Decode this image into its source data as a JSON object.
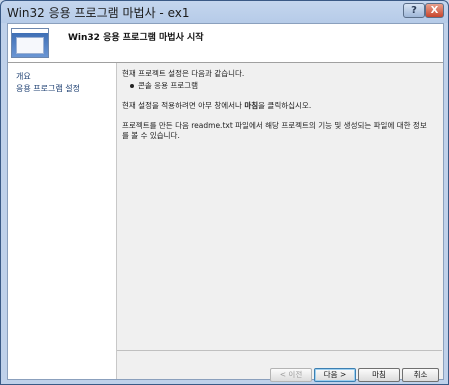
{
  "window": {
    "title": "Win32 응용 프로그램 마법사 - ex1",
    "help_label": "?",
    "close_label": "X"
  },
  "header": {
    "title": "Win32 응용 프로그램 마법사 시작"
  },
  "sidebar": {
    "items": [
      {
        "label": "개요"
      },
      {
        "label": "응용 프로그램 설정"
      }
    ]
  },
  "content": {
    "line1": "현재 프로젝트 설정은 다음과 같습니다.",
    "bullet1": "콘솔 응용 프로그램",
    "line2_pre": "현재 설정을 적용하려면 아무 창에서나 ",
    "line2_bold": "마침",
    "line2_post": "을 클릭하십시오.",
    "line3a": "프로젝트를 만든 다음 readme.txt 파일에서 해당 프로젝트의 기능 및 생성되는 파일에 대한 정보",
    "line3b": "를 볼 수 있습니다."
  },
  "buttons": {
    "prev": "< 이전",
    "next": "다음 >",
    "finish": "마침",
    "cancel": "취소"
  }
}
